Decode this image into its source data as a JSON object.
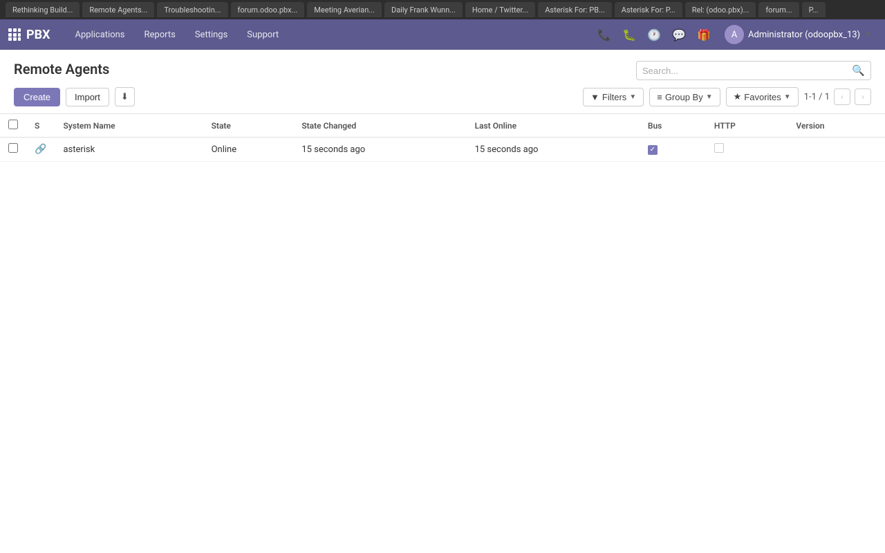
{
  "browser_tabs": [
    {
      "label": "Rethinking Build..."
    },
    {
      "label": "Remote Agents..."
    },
    {
      "label": "Troubleshootin..."
    },
    {
      "label": "forum.odoo.pbx..."
    },
    {
      "label": "Meeting Averian..."
    },
    {
      "label": "Daily Frank Wunn..."
    },
    {
      "label": "Home / Twitter..."
    },
    {
      "label": "Asterisk For: PB..."
    },
    {
      "label": "Asterisk For: P..."
    },
    {
      "label": "Rel: (odoo.pbx)..."
    },
    {
      "label": "forum..."
    },
    {
      "label": "P..."
    }
  ],
  "navbar": {
    "brand": "PBX",
    "menu_items": [
      "Applications",
      "Reports",
      "Settings",
      "Support"
    ],
    "user_label": "Administrator (odoopbx_13)",
    "user_initial": "A"
  },
  "page": {
    "title": "Remote Agents",
    "search_placeholder": "Search...",
    "toolbar": {
      "create_label": "Create",
      "import_label": "Import",
      "filters_label": "Filters",
      "group_by_label": "Group By",
      "favorites_label": "Favorites"
    },
    "pagination": {
      "current": "1-1 / 1"
    },
    "table": {
      "columns": [
        "",
        "S",
        "System Name",
        "State",
        "State Changed",
        "Last Online",
        "Bus",
        "HTTP",
        "Version"
      ],
      "rows": [
        {
          "system_name": "asterisk",
          "state": "Online",
          "state_changed": "15 seconds ago",
          "last_online": "15 seconds ago",
          "bus": true,
          "http": false,
          "version": ""
        }
      ]
    }
  }
}
